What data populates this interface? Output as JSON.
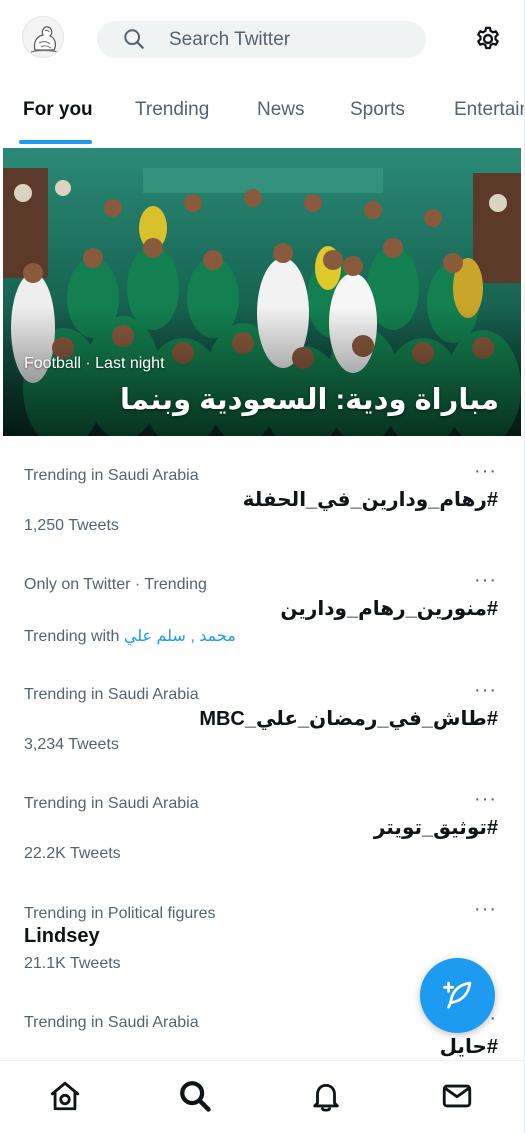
{
  "search": {
    "placeholder": "Search Twitter"
  },
  "tabs": [
    {
      "label": "For you",
      "active": true
    },
    {
      "label": "Trending"
    },
    {
      "label": "News"
    },
    {
      "label": "Sports"
    },
    {
      "label": "Entertainment"
    }
  ],
  "hero": {
    "meta": "Football · Last night",
    "headline": "مباراة ودية: السعودية وبنما"
  },
  "trends": [
    {
      "context": "Trending in Saudi Arabia",
      "name": "#رهام_ودارين_في_الحفلة",
      "count": "1,250 Tweets"
    },
    {
      "context": "Only on Twitter · Trending",
      "name": "#منورين_رهام_ودارين",
      "with_label": "Trending with",
      "with_links": "محمد , سلم علي"
    },
    {
      "context": "Trending in Saudi Arabia",
      "name": "#طاش_في_رمضان_علي_MBC",
      "count": "3,234 Tweets"
    },
    {
      "context": "Trending in Saudi Arabia",
      "name": "#توثيق_تويتر",
      "count": "22.2K Tweets"
    },
    {
      "context": "Trending in Political figures",
      "name": "Lindsey",
      "count": "21.1K Tweets"
    },
    {
      "context": "Trending in Saudi Arabia",
      "name": "#حايل"
    }
  ],
  "more_label": "···",
  "colors": {
    "accent": "#1d9bf0",
    "text": "#0f1419",
    "muted": "#536471"
  },
  "icons": {
    "search": "search-icon",
    "settings": "gear-icon",
    "compose": "compose-tweet-icon",
    "home": "home-icon",
    "explore": "search-icon",
    "notifications": "bell-icon",
    "messages": "envelope-icon"
  }
}
